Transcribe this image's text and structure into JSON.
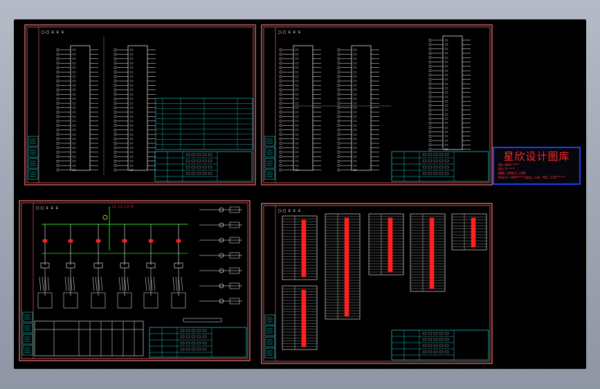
{
  "colors": {
    "frame": "#ff7a7a",
    "line": "#ffffff",
    "green": "#22dd22",
    "red": "#ff2020",
    "cyan": "#22ffff",
    "yellow": "#ffff22",
    "stamp_border": "#1d3cff"
  },
  "watermark": {
    "title": "星欣设计图库",
    "lines": [
      "QQ:464**** ",
      "QQ:3****",
      "WWW.XINSJ.COM",
      "Email:464****@qq.com TEL:135****"
    ]
  },
  "sheets": [
    {
      "id": "top-left",
      "header_label": "□-□ ε ε ε",
      "module_labels": [
        "20",
        "20"
      ]
    },
    {
      "id": "top-right",
      "header_label": "□-□ ε ε ε",
      "module_labels": [
        "20",
        "20",
        "20"
      ]
    },
    {
      "id": "bottom-left",
      "header_label": "□-□ ε ε ε",
      "power_label": "L1 L2 L3 N"
    },
    {
      "id": "bottom-right",
      "header_label": "□-□ ε ε ε"
    }
  ]
}
